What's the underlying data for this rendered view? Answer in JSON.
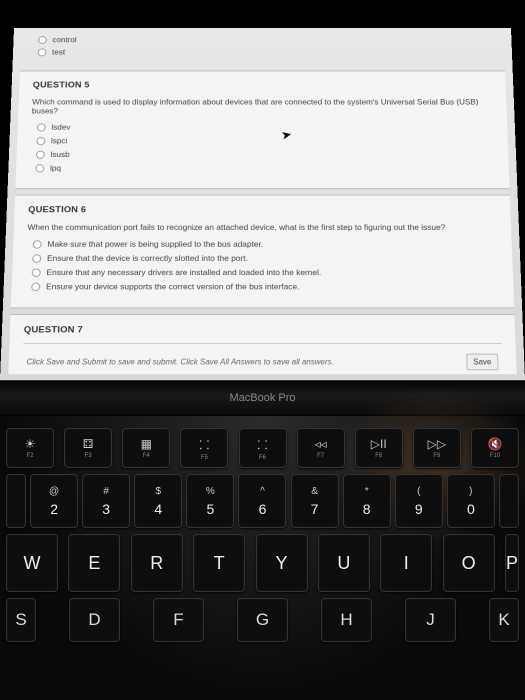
{
  "prev_question": {
    "options": [
      "control",
      "test"
    ]
  },
  "q5": {
    "title": "QUESTION 5",
    "prompt": "Which command is used to display information about devices that are connected to the system's Universal Serial Bus (USB) buses?",
    "options": [
      "lsdev",
      "lspci",
      "lsusb",
      "lpq"
    ]
  },
  "q6": {
    "title": "QUESTION 6",
    "prompt": "When the communication port fails to recognize an attached device, what is the first step to figuring out the issue?",
    "options": [
      "Make sure that power is being supplied to the bus adapter.",
      "Ensure that the device is correctly slotted into the port.",
      "Ensure that any necessary drivers are installed and loaded into the kernel.",
      "Ensure your device supports the correct version of the bus interface."
    ]
  },
  "q7": {
    "title": "QUESTION 7"
  },
  "footer": {
    "instructions": "Click Save and Submit to save and submit. Click Save All Answers to save all answers.",
    "save_label": "Save"
  },
  "hinge_label": "MacBook Pro",
  "fn_keys": [
    {
      "sym": "☀",
      "label": "F2"
    },
    {
      "sym": "⚃",
      "label": "F3"
    },
    {
      "sym": "▦",
      "label": "F4"
    },
    {
      "sym": "⸬",
      "label": "F5"
    },
    {
      "sym": "⸬",
      "label": "F6"
    },
    {
      "sym": "◃◃",
      "label": "F7"
    },
    {
      "sym": "▷II",
      "label": "F8"
    },
    {
      "sym": "▷▷",
      "label": "F9"
    },
    {
      "sym": "🔇",
      "label": "F10"
    }
  ],
  "num_keys": [
    {
      "top": "@",
      "bot": "2"
    },
    {
      "top": "#",
      "bot": "3"
    },
    {
      "top": "$",
      "bot": "4"
    },
    {
      "top": "%",
      "bot": "5"
    },
    {
      "top": "^",
      "bot": "6"
    },
    {
      "top": "&",
      "bot": "7"
    },
    {
      "top": "*",
      "bot": "8"
    },
    {
      "top": "(",
      "bot": "9"
    },
    {
      "top": ")",
      "bot": "0"
    }
  ],
  "letter_row": [
    "W",
    "E",
    "R",
    "T",
    "Y",
    "U",
    "I",
    "O",
    "P"
  ],
  "letter_row2": [
    "S",
    "D",
    "F",
    "G",
    "H",
    "J",
    "K"
  ]
}
